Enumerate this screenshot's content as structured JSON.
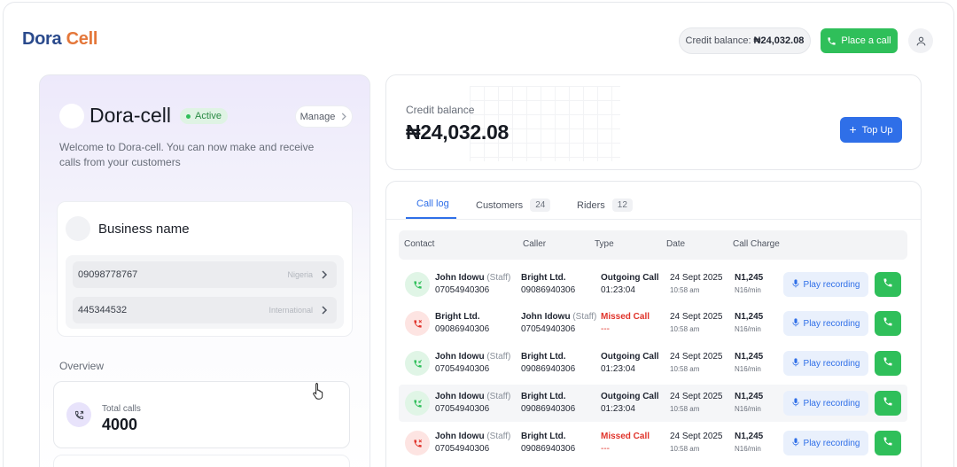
{
  "header": {
    "logo_part1": "Dora",
    "logo_part2": "Cell",
    "credit_label": "Credit balance:",
    "credit_value": "₦24,032.08",
    "place_call": "Place a call"
  },
  "profile": {
    "name": "Dora-cell",
    "status": "Active",
    "manage": "Manage",
    "welcome": "Welcome to Dora-cell. You can now make and receive calls from your customers"
  },
  "business": {
    "title": "Business name",
    "numbers": [
      {
        "number": "09098778767",
        "region": "Nigeria"
      },
      {
        "number": "445344532",
        "region": "International"
      }
    ]
  },
  "overview": {
    "title": "Overview",
    "total_calls_label": "Total calls",
    "total_calls_value": "4000"
  },
  "credit": {
    "label": "Credit balance",
    "value": "₦24,032.08",
    "topup": "Top Up"
  },
  "tabs": [
    {
      "label": "Call log",
      "count": ""
    },
    {
      "label": "Customers",
      "count": "24"
    },
    {
      "label": "Riders",
      "count": "12"
    }
  ],
  "table": {
    "headers": [
      "Contact",
      "Caller",
      "Type",
      "Date",
      "Call Charge"
    ],
    "play_label": "Play recording",
    "rows": [
      {
        "kind": "in",
        "contact": "John Idowu",
        "contact_tag": "(Staff)",
        "contact_phone": "07054940306",
        "caller": "Bright Ltd.",
        "caller_tag": "",
        "caller_phone": "09086940306",
        "type": "Outgoing Call",
        "duration": "01:23:04",
        "date": "24 Sept 2025",
        "time": "10:58 am",
        "charge": "N1,245",
        "rate": "N16/min"
      },
      {
        "kind": "miss",
        "contact": "Bright Ltd.",
        "contact_tag": "",
        "contact_phone": "09086940306",
        "caller": "John Idowu",
        "caller_tag": "(Staff)",
        "caller_phone": "07054940306",
        "type": "Missed Call",
        "duration": "---",
        "date": "24 Sept 2025",
        "time": "10:58 am",
        "charge": "N1,245",
        "rate": "N16/min"
      },
      {
        "kind": "in",
        "contact": "John Idowu",
        "contact_tag": "(Staff)",
        "contact_phone": "07054940306",
        "caller": "Bright Ltd.",
        "caller_tag": "",
        "caller_phone": "09086940306",
        "type": "Outgoing Call",
        "duration": "01:23:04",
        "date": "24 Sept 2025",
        "time": "10:58 am",
        "charge": "N1,245",
        "rate": "N16/min"
      },
      {
        "kind": "in",
        "contact": "John Idowu",
        "contact_tag": "(Staff)",
        "contact_phone": "07054940306",
        "caller": "Bright Ltd.",
        "caller_tag": "",
        "caller_phone": "09086940306",
        "type": "Outgoing Call",
        "duration": "01:23:04",
        "date": "24 Sept 2025",
        "time": "10:58 am",
        "charge": "N1,245",
        "rate": "N16/min"
      },
      {
        "kind": "miss",
        "contact": "John Idowu",
        "contact_tag": "(Staff)",
        "contact_phone": "07054940306",
        "caller": "Bright Ltd.",
        "caller_tag": "",
        "caller_phone": "09086940306",
        "type": "Missed Call",
        "duration": "---",
        "date": "24 Sept 2025",
        "time": "10:58 am",
        "charge": "N1,245",
        "rate": "N16/min"
      }
    ]
  },
  "colors": {
    "accent_blue": "#2f6fe8",
    "call_green": "#2fbf5a",
    "missed_red": "#e0332a",
    "logo_blue": "#2a4a8c",
    "logo_orange": "#e4773a"
  }
}
